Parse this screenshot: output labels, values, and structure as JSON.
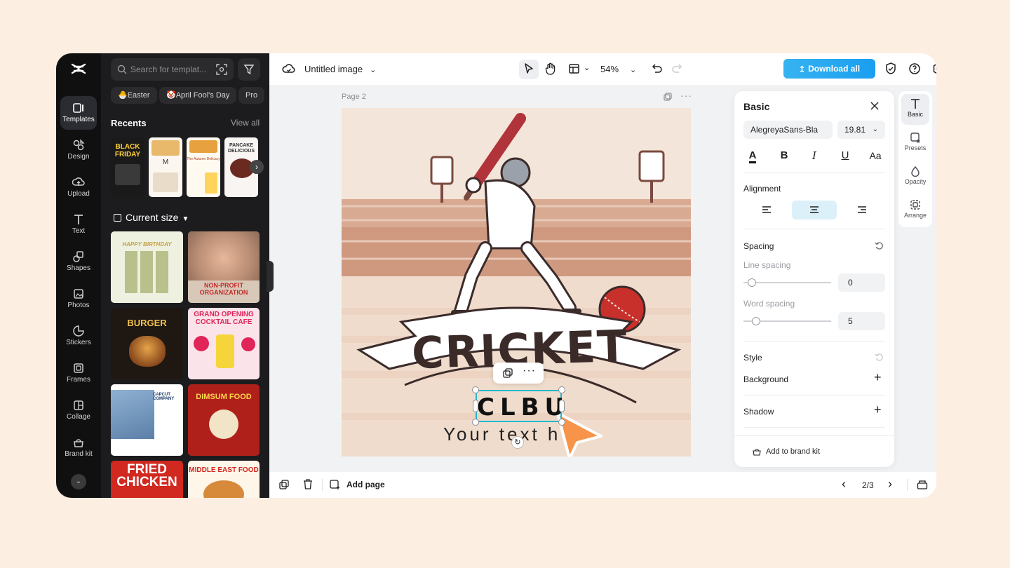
{
  "app": {
    "doc_title": "Untitled image",
    "zoom": "54%",
    "download_label": "Download all"
  },
  "rail": {
    "items": [
      {
        "label": "Templates",
        "icon": "templates-icon"
      },
      {
        "label": "Design",
        "icon": "design-icon"
      },
      {
        "label": "Upload",
        "icon": "upload-icon"
      },
      {
        "label": "Text",
        "icon": "text-icon"
      },
      {
        "label": "Shapes",
        "icon": "shapes-icon"
      },
      {
        "label": "Photos",
        "icon": "photos-icon"
      },
      {
        "label": "Stickers",
        "icon": "stickers-icon"
      },
      {
        "label": "Frames",
        "icon": "frames-icon"
      },
      {
        "label": "Collage",
        "icon": "collage-icon"
      },
      {
        "label": "Brand kit",
        "icon": "brand-kit-icon"
      }
    ]
  },
  "panel": {
    "search_placeholder": "Search for templat...",
    "chips": [
      "🐣Easter",
      "🤡April Fool's Day",
      "Pro"
    ],
    "recents_title": "Recents",
    "view_all": "View all",
    "recent_thumbs": [
      {
        "text": "BLACK FRIDAY"
      },
      {
        "text": "M"
      },
      {
        "text": "The Autumn Delicacy"
      },
      {
        "text": "PANCAKE DELICIOUS"
      }
    ],
    "size_title": "Current size",
    "templates": [
      {
        "text": "HAPPY BIRTHDAY"
      },
      {
        "text": "NON-PROFIT ORGANIZATION"
      },
      {
        "text": "BURGER"
      },
      {
        "text": "GRAND OPENING COCKTAIL CAFE"
      },
      {
        "text": "CAPCUT COMPANY"
      },
      {
        "text": "DIMSUM FOOD"
      },
      {
        "text": "FRIED CHICKEN"
      },
      {
        "text": "MIDDLE EAST FOOD"
      }
    ]
  },
  "canvas": {
    "page_label": "Page 2",
    "title": "CRICKET",
    "selected_text": "CLBU",
    "body_text": "Your text h"
  },
  "props": {
    "header": "Basic",
    "font": "AlegreyaSans-Bla",
    "font_size": "19.81",
    "alignment_label": "Alignment",
    "spacing_label": "Spacing",
    "line_spacing_label": "Line spacing",
    "line_spacing_value": "0",
    "word_spacing_label": "Word spacing",
    "word_spacing_value": "5",
    "style_label": "Style",
    "background_label": "Background",
    "shadow_label": "Shadow",
    "brand_kit_label": "Add to brand kit"
  },
  "side_tabs": [
    {
      "label": "Basic",
      "icon": "basic-text-icon"
    },
    {
      "label": "Presets",
      "icon": "presets-icon"
    },
    {
      "label": "Opacity",
      "icon": "opacity-icon"
    },
    {
      "label": "Arrange",
      "icon": "arrange-icon"
    }
  ],
  "bottom": {
    "add_page": "Add page",
    "page_counter": "2/3"
  },
  "colors": {
    "accent": "#1a9ef0",
    "selection": "#22b8cf",
    "rail_bg": "#101010",
    "panel_bg": "#1c1c1e",
    "cursor": "#f7944a",
    "ball": "#c8302c"
  }
}
